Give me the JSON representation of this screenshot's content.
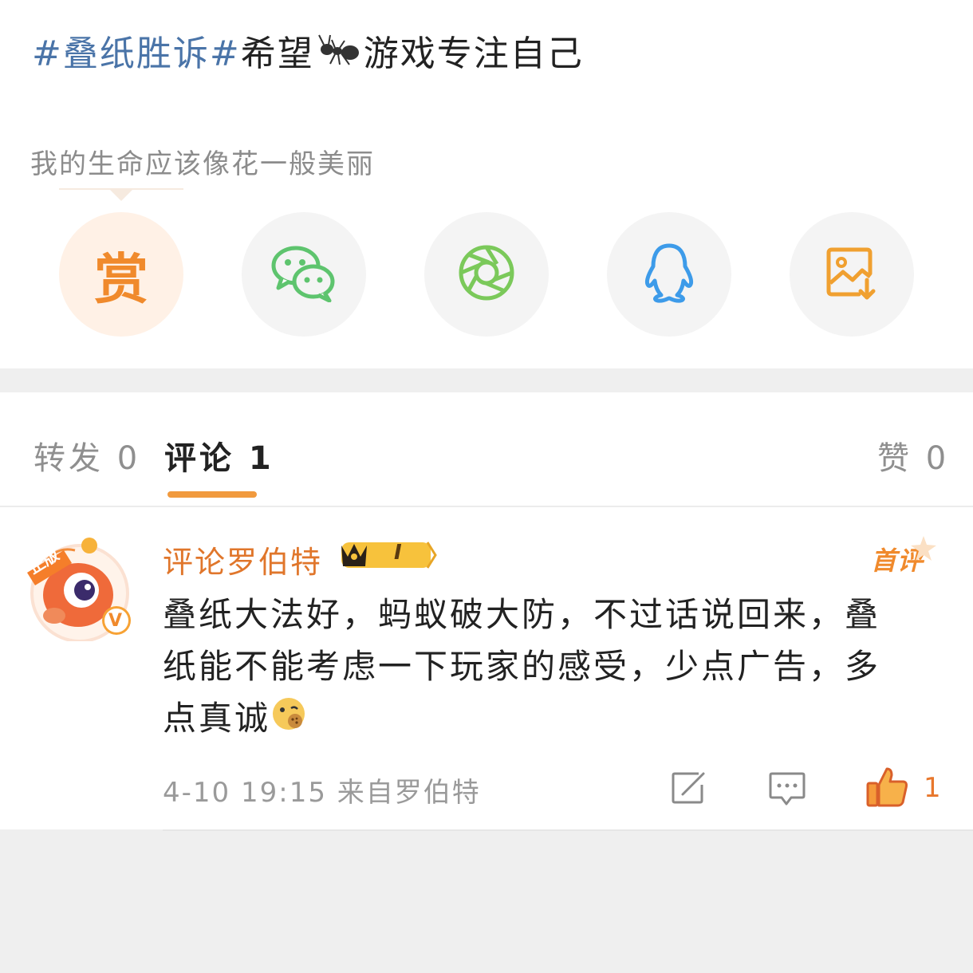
{
  "post": {
    "hashtag": "#叠纸胜诉#",
    "text_before_emoji": "希望",
    "text_after_emoji": "游戏专注自己",
    "emoji_icon": "ant-icon",
    "motto": "我的生命应该像花一般美丽"
  },
  "share": {
    "reward_label": "赏",
    "buttons": [
      "reward",
      "wechat-icon",
      "moments-icon",
      "qq-icon",
      "save-image-icon"
    ]
  },
  "tabs": {
    "repost": "转发 0",
    "comment": "评论 1",
    "like": "赞 0"
  },
  "comment": {
    "username": "评论罗伯特",
    "level": "I",
    "first_badge": "首评",
    "avatar_badge": "正版",
    "body": "叠纸大法好，蚂蚁破大防，不过话说回来，叠纸能不能考虑一下玩家的感受，少点广告，多点真诚",
    "time_source": "4-10 19:15 来自罗伯特",
    "like_count": "1"
  },
  "colors": {
    "accent": "#f19a3e",
    "username": "#e0762b",
    "hashtag": "#4a74a8"
  }
}
